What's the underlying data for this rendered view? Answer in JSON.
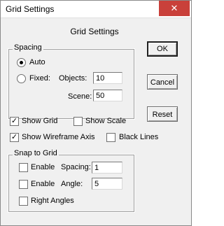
{
  "window": {
    "title": "Grid Settings",
    "close_glyph": "✕"
  },
  "dialog": {
    "heading": "Grid Settings"
  },
  "spacing": {
    "legend": "Spacing",
    "auto_label": "Auto",
    "fixed_label": "Fixed:",
    "selected": "Auto",
    "objects_label": "Objects:",
    "objects_value": "10",
    "scene_label": "Scene:",
    "scene_value": "50"
  },
  "options": {
    "show_grid": {
      "label": "Show Grid",
      "checked": true,
      "mark": "✓"
    },
    "show_scale": {
      "label": "Show Scale",
      "checked": false
    },
    "show_wireframe_axis": {
      "label": "Show Wireframe Axis",
      "checked": true,
      "mark": "✓"
    },
    "black_lines": {
      "label": "Black Lines",
      "checked": false
    }
  },
  "snap": {
    "legend": "Snap to Grid",
    "enable_spacing_label": "Enable",
    "spacing_label": "Spacing:",
    "spacing_value": "1",
    "enable_angle_label": "Enable",
    "angle_label": "Angle:",
    "angle_value": "5",
    "right_angles_label": "Right Angles"
  },
  "buttons": {
    "ok": "OK",
    "cancel": "Cancel",
    "reset": "Reset"
  }
}
